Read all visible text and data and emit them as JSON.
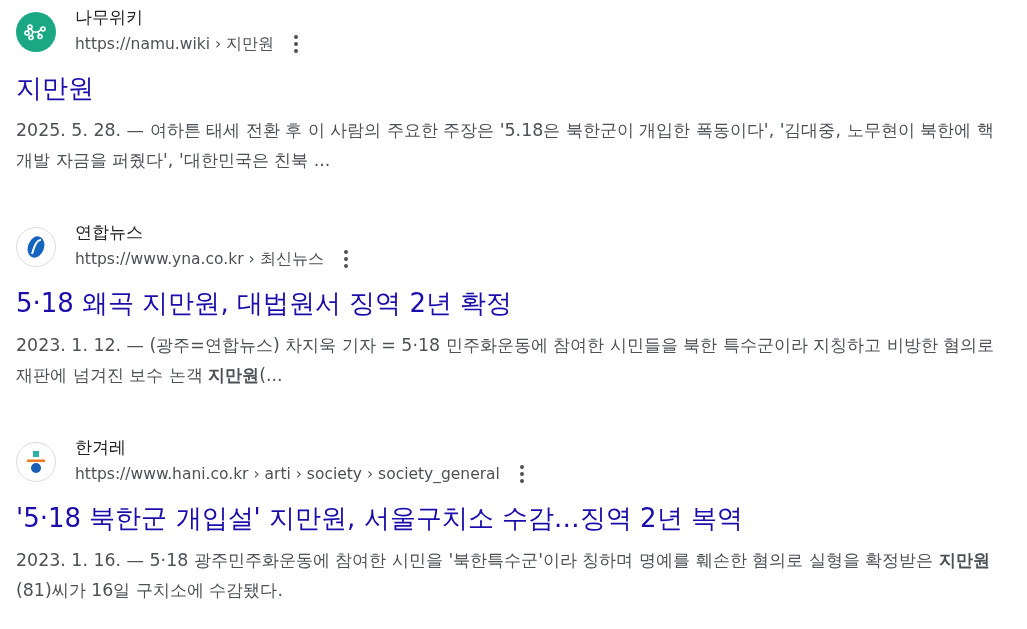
{
  "results": [
    {
      "site": "나무위키",
      "logo": {
        "kind": "namu"
      },
      "url": "https://namu.wiki › 지만원",
      "title": "지만원",
      "date": "2025. 5. 28. —",
      "snippet": "여하튼 태세 전환 후 이 사람의 주요한 주장은 '5.18은 북한군이 개입한 폭동이다', '김대중, 노무현이 북한에 핵개발 자금을 퍼줬다', '대한민국은 친북 ..."
    },
    {
      "site": "연합뉴스",
      "logo": {
        "kind": "yna"
      },
      "url": "https://www.yna.co.kr › 최신뉴스",
      "title": "5·18 왜곡 지만원, 대법원서 징역 2년 확정",
      "date": "2023. 1. 12. —",
      "snippet": "(광주=연합뉴스) 차지욱 기자 = 5·18 민주화운동에 참여한 시민들을 북한 특수군이라 지칭하고 비방한 혐의로 재판에 넘겨진 보수 논객 **지만원**(..."
    },
    {
      "site": "한겨레",
      "logo": {
        "kind": "hani"
      },
      "url": "https://www.hani.co.kr › arti › society › society_general",
      "title": "'5·18 북한군 개입설' 지만원, 서울구치소 수감…징역 2년 복역",
      "date": "2023. 1. 16. —",
      "snippet": "5·18 광주민주화운동에 참여한 시민을 '북한특수군'이라 칭하며 명예를 훼손한 혐의로 실형을 확정받은 **지만원**(81)씨가 16일 구치소에 수감됐다."
    }
  ]
}
